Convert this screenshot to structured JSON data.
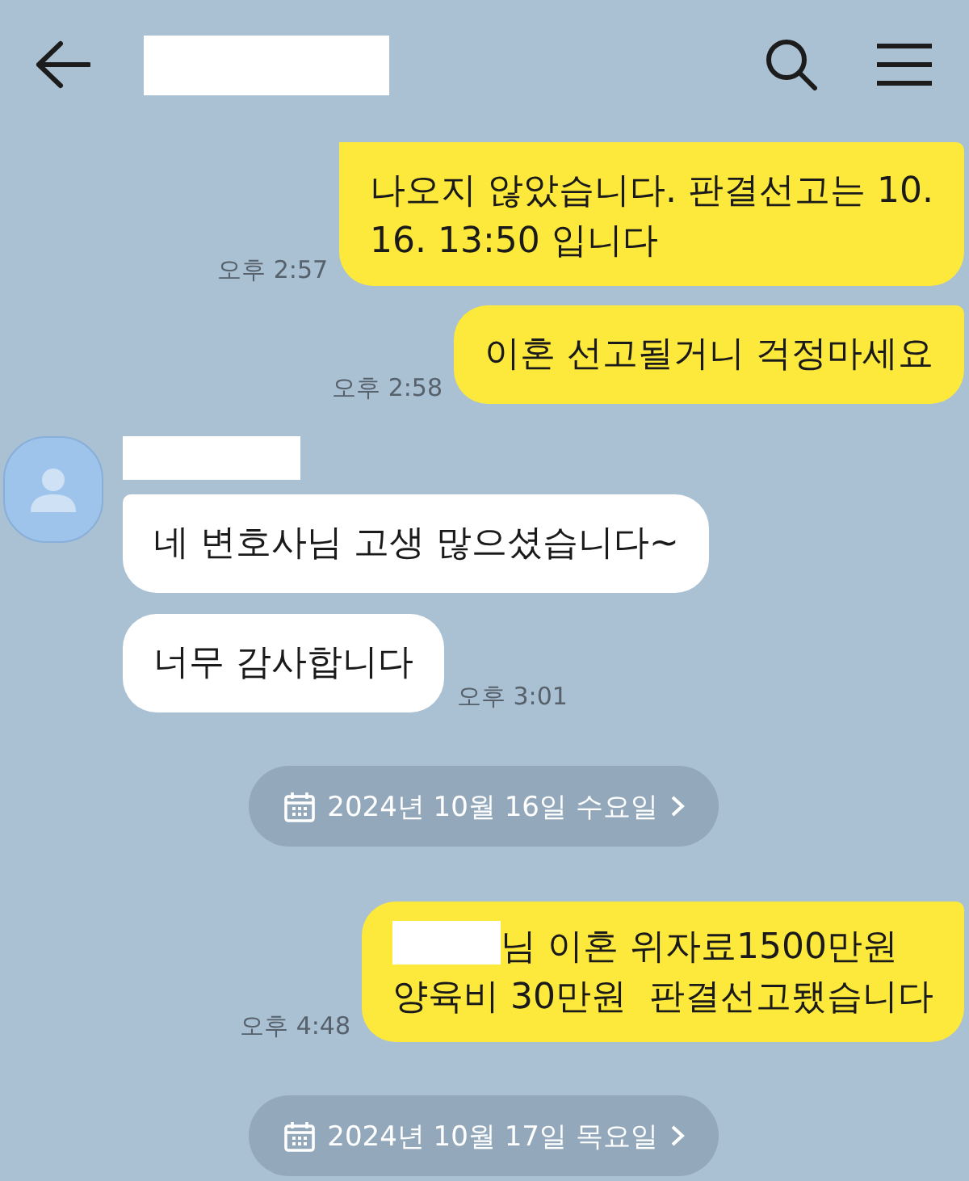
{
  "header": {
    "title_redacted": true
  },
  "messages": [
    {
      "kind": "outgoing",
      "clipped_top": true,
      "text": "나오지 않았습니다. 판결선고는 10.\n16. 13:50 입니다",
      "time": "오후 2:57"
    },
    {
      "kind": "outgoing",
      "text": "이혼 선고될거니 걱정마세요",
      "time": "오후 2:58"
    },
    {
      "kind": "incoming",
      "sender": {
        "name_redacted": true
      },
      "bubbles": [
        {
          "text": "네 변호사님 고생 많으셨습니다~"
        },
        {
          "text": "너무 감사합니다",
          "time": "오후 3:01"
        }
      ]
    },
    {
      "kind": "date",
      "text": "2024년 10월 16일 수요일"
    },
    {
      "kind": "outgoing",
      "redacted_prefix": true,
      "text": "님 이혼 위자료1500만원\n양육비 30만원  판결선고됐습니다",
      "time": "오후 4:48"
    },
    {
      "kind": "date",
      "text": "2024년 10월 17일 목요일"
    }
  ]
}
